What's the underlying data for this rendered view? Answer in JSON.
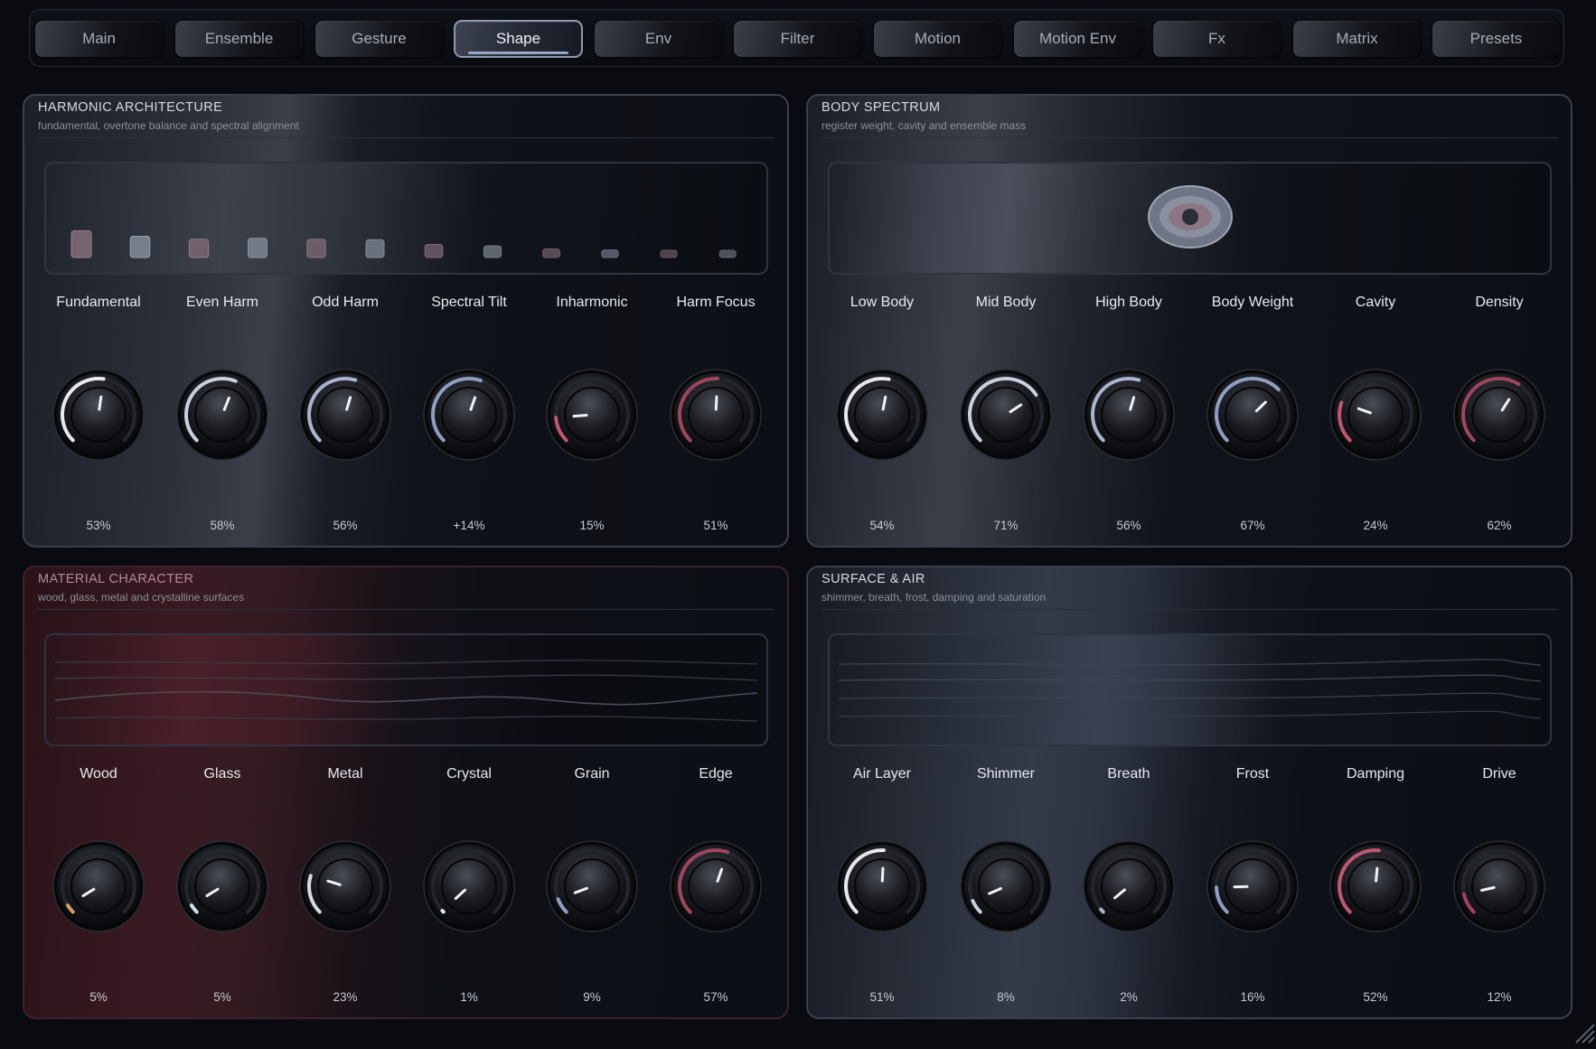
{
  "tabs": [
    {
      "label": "Main"
    },
    {
      "label": "Ensemble"
    },
    {
      "label": "Gesture"
    },
    {
      "label": "Shape",
      "active": true
    },
    {
      "label": "Env"
    },
    {
      "label": "Filter"
    },
    {
      "label": "Motion"
    },
    {
      "label": "Motion Env"
    },
    {
      "label": "Fx"
    },
    {
      "label": "Matrix"
    },
    {
      "label": "Presets"
    }
  ],
  "panels": {
    "harmonic": {
      "title": "HARMONIC ARCHITECTURE",
      "subtitle": "fundamental, overtone balance and spectral alignment",
      "bars": [
        0.53,
        0.42,
        0.36,
        0.38,
        0.36,
        0.35,
        0.26,
        0.23,
        0.17,
        0.15,
        0.14,
        0.12
      ],
      "controls": [
        {
          "label": "Fundamental",
          "value": "53%",
          "level": 0.53,
          "color": "#e6e8ee"
        },
        {
          "label": "Even Harm",
          "value": "58%",
          "level": 0.58,
          "color": "#c9cfde"
        },
        {
          "label": "Odd Harm",
          "value": "56%",
          "level": 0.56,
          "color": "#a9b4cf"
        },
        {
          "label": "Spectral Tilt",
          "value": "+14%",
          "level": 0.57,
          "color": "#8e9dc2"
        },
        {
          "label": "Inharmonic",
          "value": "15%",
          "level": 0.15,
          "color": "#c0566f"
        },
        {
          "label": "Harm Focus",
          "value": "51%",
          "level": 0.51,
          "color": "#a0455d"
        }
      ]
    },
    "body": {
      "title": "BODY SPECTRUM",
      "subtitle": "register weight, cavity and ensemble mass",
      "controls": [
        {
          "label": "Low Body",
          "value": "54%",
          "level": 0.54,
          "color": "#e6e8ee"
        },
        {
          "label": "Mid Body",
          "value": "71%",
          "level": 0.71,
          "color": "#c9cfde"
        },
        {
          "label": "High Body",
          "value": "56%",
          "level": 0.56,
          "color": "#a9b4cf"
        },
        {
          "label": "Body Weight",
          "value": "67%",
          "level": 0.67,
          "color": "#8e9dc2"
        },
        {
          "label": "Cavity",
          "value": "24%",
          "level": 0.24,
          "color": "#c0566f"
        },
        {
          "label": "Density",
          "value": "62%",
          "level": 0.62,
          "color": "#a0455d"
        }
      ]
    },
    "material": {
      "title": "MATERIAL CHARACTER",
      "subtitle": "wood, glass, metal and crystalline surfaces",
      "controls": [
        {
          "label": "Wood",
          "value": "5%",
          "level": 0.05,
          "color": "#d99a63"
        },
        {
          "label": "Glass",
          "value": "5%",
          "level": 0.05,
          "color": "#c9e2ea"
        },
        {
          "label": "Metal",
          "value": "23%",
          "level": 0.23,
          "color": "#d6d9e0"
        },
        {
          "label": "Crystal",
          "value": "1%",
          "level": 0.01,
          "color": "#e8ecf3"
        },
        {
          "label": "Grain",
          "value": "9%",
          "level": 0.09,
          "color": "#8e9dc2"
        },
        {
          "label": "Edge",
          "value": "57%",
          "level": 0.57,
          "color": "#a0455d"
        }
      ]
    },
    "surface": {
      "title": "SURFACE & AIR",
      "subtitle": "shimmer, breath, frost, damping and saturation",
      "controls": [
        {
          "label": "Air Layer",
          "value": "51%",
          "level": 0.51,
          "color": "#e6e8ee"
        },
        {
          "label": "Shimmer",
          "value": "8%",
          "level": 0.08,
          "color": "#c9cfde"
        },
        {
          "label": "Breath",
          "value": "2%",
          "level": 0.02,
          "color": "#a9b4cf"
        },
        {
          "label": "Frost",
          "value": "16%",
          "level": 0.16,
          "color": "#8e9dc2"
        },
        {
          "label": "Damping",
          "value": "52%",
          "level": 0.52,
          "color": "#c0566f"
        },
        {
          "label": "Drive",
          "value": "12%",
          "level": 0.12,
          "color": "#a0455d"
        }
      ]
    }
  }
}
